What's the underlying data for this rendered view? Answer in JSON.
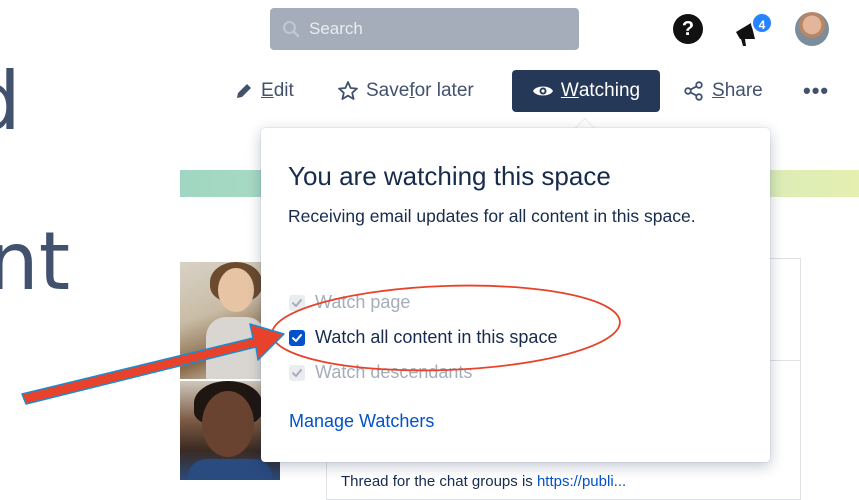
{
  "background": {
    "letter_top": "d",
    "letter_bottom": "nt",
    "content_text": "Thread for the chat groups is ",
    "content_link": "https://publi..."
  },
  "topbar": {
    "search_placeholder": "Search",
    "help_label": "?",
    "notifications_count": "4"
  },
  "toolbar": {
    "edit_pre": "",
    "edit_ul": "E",
    "edit_post": "dit",
    "save_pre": "Save ",
    "save_ul": "f",
    "save_post": "or later",
    "watch_pre": "",
    "watch_ul": "W",
    "watch_post": "atching",
    "share_pre": "",
    "share_ul": "S",
    "share_post": "hare",
    "more_label": "•••"
  },
  "popover": {
    "title": "You are watching this space",
    "description": "Receiving email updates for all content in this space.",
    "options": [
      {
        "label": "Watch page",
        "checked": true,
        "disabled": true
      },
      {
        "label": "Watch all content in this space",
        "checked": true,
        "disabled": false
      },
      {
        "label": "Watch descendants",
        "checked": true,
        "disabled": true
      }
    ],
    "manage_link": "Manage Watchers"
  },
  "colors": {
    "watch_button_bg": "#253858",
    "link_blue": "#0052cc",
    "checkbox_blue": "#0052cc",
    "annotation_red": "#e8432a",
    "annotation_outline": "#1b8bd1"
  }
}
